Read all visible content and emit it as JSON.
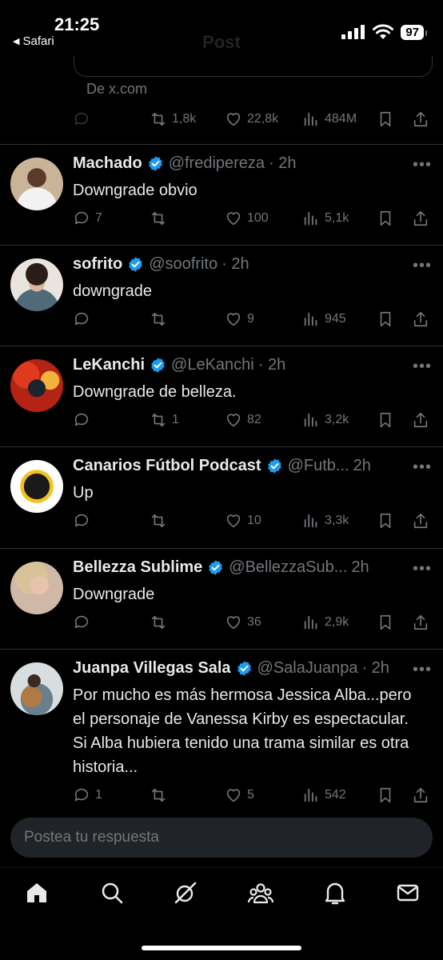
{
  "status_bar": {
    "time": "21:25",
    "back_app": "Safari",
    "battery": "97"
  },
  "header": {
    "title": "Post"
  },
  "quoted": {
    "source": "De x.com"
  },
  "main_post_actions": {
    "replies": "",
    "reposts": "1,8k",
    "likes": "22,8k",
    "views": "484M"
  },
  "tweets": [
    {
      "name": "Machado",
      "handle": "@fredipereza",
      "time": "· 2h",
      "text": "Downgrade obvio",
      "replies": "7",
      "reposts": "",
      "likes": "100",
      "views": "5,1k"
    },
    {
      "name": "sofrito",
      "handle": "@soofrito",
      "time": "· 2h",
      "text": "downgrade",
      "replies": "",
      "reposts": "",
      "likes": "9",
      "views": "945"
    },
    {
      "name": "LeKanchi",
      "handle": "@LeKanchi",
      "time": "· 2h",
      "text": "Downgrade de belleza.",
      "replies": "",
      "reposts": "1",
      "likes": "82",
      "views": "3,2k"
    },
    {
      "name": "Canarios Fútbol Podcast",
      "handle": "@Futb...",
      "time": "2h",
      "text": "Up",
      "replies": "",
      "reposts": "",
      "likes": "10",
      "views": "3,3k"
    },
    {
      "name": "Bellezza Sublime",
      "handle": "@BellezzaSub...",
      "time": "2h",
      "text": "Downgrade",
      "replies": "",
      "reposts": "",
      "likes": "36",
      "views": "2,9k"
    },
    {
      "name": "Juanpa Villegas Sala",
      "handle": "@SalaJuanpa",
      "time": "· 2h",
      "text": "Por mucho es más hermosa Jessica Alba...pero el personaje de Vanessa Kirby es espectacular. Si Alba hubiera tenido una trama similar es otra historia...",
      "replies": "1",
      "reposts": "",
      "likes": "5",
      "views": "542"
    }
  ],
  "reply": {
    "placeholder": "Postea tu respuesta"
  },
  "tabs": [
    "home-icon",
    "search-icon",
    "grok-icon",
    "communities-icon",
    "notifications-icon",
    "messages-icon"
  ],
  "colors": {
    "background": "#000000",
    "text": "#e7e9ea",
    "muted": "#71767b",
    "verified": "#1d9bf0",
    "divider": "#2f3336"
  }
}
